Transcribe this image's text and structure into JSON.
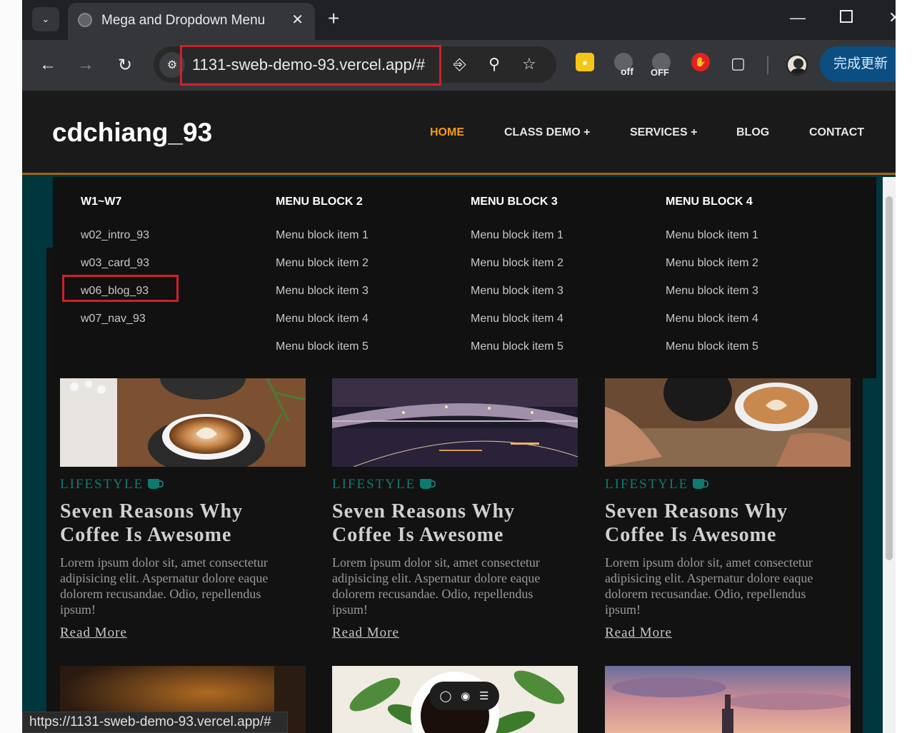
{
  "browser": {
    "tab_title": "Mega and Dropdown Menu",
    "url": "1131-sweb-demo-93.vercel.app/#",
    "update_button": "完成更新",
    "ext_off_1": "off",
    "ext_off_2": "OFF",
    "status_url": "https://1131-sweb-demo-93.vercel.app/#"
  },
  "site": {
    "logo": "cdchiang_93",
    "nav": [
      "HOME",
      "CLASS DEMO +",
      "SERVICES +",
      "BLOG",
      "CONTACT"
    ],
    "active_nav": "HOME",
    "accent_color": "#f39c12"
  },
  "mega_menu": {
    "columns": [
      {
        "title": "W1~W7",
        "items": [
          "w02_intro_93",
          "w03_card_93",
          "w06_blog_93",
          "w07_nav_93"
        ]
      },
      {
        "title": "MENU BLOCK 2",
        "items": [
          "Menu block item 1",
          "Menu block item 2",
          "Menu block item 3",
          "Menu block item 4",
          "Menu block item 5"
        ]
      },
      {
        "title": "MENU BLOCK 3",
        "items": [
          "Menu block item 1",
          "Menu block item 2",
          "Menu block item 3",
          "Menu block item 4",
          "Menu block item 5"
        ]
      },
      {
        "title": "MENU BLOCK 4",
        "items": [
          "Menu block item 1",
          "Menu block item 2",
          "Menu block item 3",
          "Menu block item 4",
          "Menu block item 5"
        ]
      }
    ],
    "highlighted_item": "w06_blog_93"
  },
  "cards": [
    {
      "category": "LIFESTYLE",
      "title": "Seven Reasons Why Coffee Is Awesome",
      "text": "Lorem ipsum dolor sit, amet consectetur adipisicing elit. Aspernatur dolore eaque dolorem recusandae. Odio, repellendus ipsum!",
      "link": "Read More",
      "image": "latte-art-photo"
    },
    {
      "category": "LIFESTYLE",
      "title": "Seven Reasons Why Coffee Is Awesome",
      "text": "Lorem ipsum dolor sit, amet consectetur adipisicing elit. Aspernatur dolore eaque dolorem recusandae. Odio, repellendus ipsum!",
      "link": "Read More",
      "image": "bridge-night-photo"
    },
    {
      "category": "LIFESTYLE",
      "title": "Seven Reasons Why Coffee Is Awesome",
      "text": "Lorem ipsum dolor sit, amet consectetur adipisicing elit. Aspernatur dolore eaque dolorem recusandae. Odio, repellendus ipsum!",
      "link": "Read More",
      "image": "hands-coffee-photo"
    }
  ]
}
